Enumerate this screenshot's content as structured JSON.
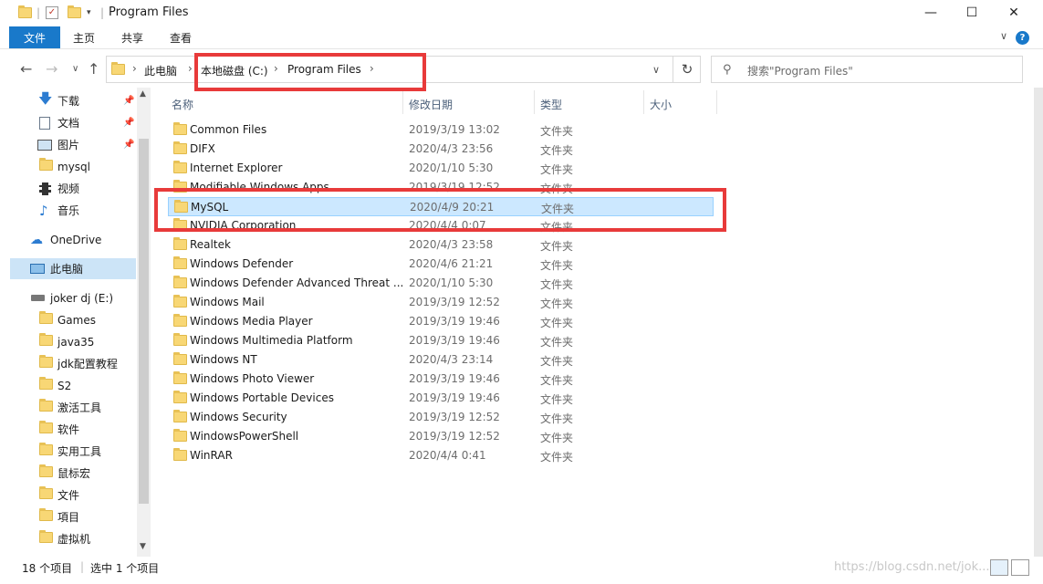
{
  "window": {
    "title": "Program Files",
    "controls": {
      "minimize": "—",
      "maximize": "☐",
      "close": "✕"
    }
  },
  "ribbon": {
    "file_tab": "文件",
    "tabs": [
      "主页",
      "共享",
      "查看"
    ],
    "help": "?",
    "collapse": "∨"
  },
  "nav": {
    "back": "←",
    "forward": "→",
    "recent": "∨",
    "up": "↑",
    "breadcrumb": [
      "此电脑",
      "本地磁盘 (C:)",
      "Program Files"
    ],
    "separator": "›",
    "dropdown": "∨",
    "refresh": "↻"
  },
  "search": {
    "placeholder": "搜索\"Program Files\"",
    "icon": "search-icon"
  },
  "sidebar": {
    "quick_access": [
      {
        "label": "下载",
        "icon": "download-icon",
        "pinned": true
      },
      {
        "label": "文档",
        "icon": "document-icon",
        "pinned": true
      },
      {
        "label": "图片",
        "icon": "picture-icon",
        "pinned": true
      },
      {
        "label": "mysql",
        "icon": "folder-icon",
        "pinned": false
      },
      {
        "label": "视频",
        "icon": "video-icon",
        "pinned": false
      },
      {
        "label": "音乐",
        "icon": "music-icon",
        "pinned": false
      }
    ],
    "onedrive": "OneDrive",
    "this_pc": "此电脑",
    "drive": "joker dj (E:)",
    "drive_folders": [
      "Games",
      "java35",
      "jdk配置教程",
      "S2",
      "激活工具",
      "软件",
      "实用工具",
      "鼠标宏",
      "文件",
      "項目",
      "虚拟机"
    ]
  },
  "columns": {
    "name": "名称",
    "date": "修改日期",
    "type": "类型",
    "size": "大小"
  },
  "files": [
    {
      "name": "Common Files",
      "date": "2019/3/19 13:02",
      "type": "文件夹"
    },
    {
      "name": "DIFX",
      "date": "2020/4/3 23:56",
      "type": "文件夹"
    },
    {
      "name": "Internet Explorer",
      "date": "2020/1/10 5:30",
      "type": "文件夹"
    },
    {
      "name": "Modifiable Windows Apps",
      "date": "2019/3/19 12:52",
      "type": "文件夹"
    },
    {
      "name": "MySQL",
      "date": "2020/4/9 20:21",
      "type": "文件夹",
      "selected": true
    },
    {
      "name": "NVIDIA Corporation",
      "date": "2020/4/4 0:07",
      "type": "文件夹"
    },
    {
      "name": "Realtek",
      "date": "2020/4/3 23:58",
      "type": "文件夹"
    },
    {
      "name": "Windows Defender",
      "date": "2020/4/6 21:21",
      "type": "文件夹"
    },
    {
      "name": "Windows Defender Advanced Threat ...",
      "date": "2020/1/10 5:30",
      "type": "文件夹"
    },
    {
      "name": "Windows Mail",
      "date": "2019/3/19 12:52",
      "type": "文件夹"
    },
    {
      "name": "Windows Media Player",
      "date": "2019/3/19 19:46",
      "type": "文件夹"
    },
    {
      "name": "Windows Multimedia Platform",
      "date": "2019/3/19 19:46",
      "type": "文件夹"
    },
    {
      "name": "Windows NT",
      "date": "2020/4/3 23:14",
      "type": "文件夹"
    },
    {
      "name": "Windows Photo Viewer",
      "date": "2019/3/19 19:46",
      "type": "文件夹"
    },
    {
      "name": "Windows Portable Devices",
      "date": "2019/3/19 19:46",
      "type": "文件夹"
    },
    {
      "name": "Windows Security",
      "date": "2019/3/19 12:52",
      "type": "文件夹"
    },
    {
      "name": "WindowsPowerShell",
      "date": "2019/3/19 12:52",
      "type": "文件夹"
    },
    {
      "name": "WinRAR",
      "date": "2020/4/4 0:41",
      "type": "文件夹"
    }
  ],
  "status": {
    "count": "18 个项目",
    "selected": "选中 1 个项目"
  },
  "watermark": "https://blog.csdn.net/jok...",
  "colors": {
    "accent": "#1979ca",
    "highlight": "#e83a3a",
    "selection": "#cce8ff",
    "folder": "#f8d775"
  }
}
